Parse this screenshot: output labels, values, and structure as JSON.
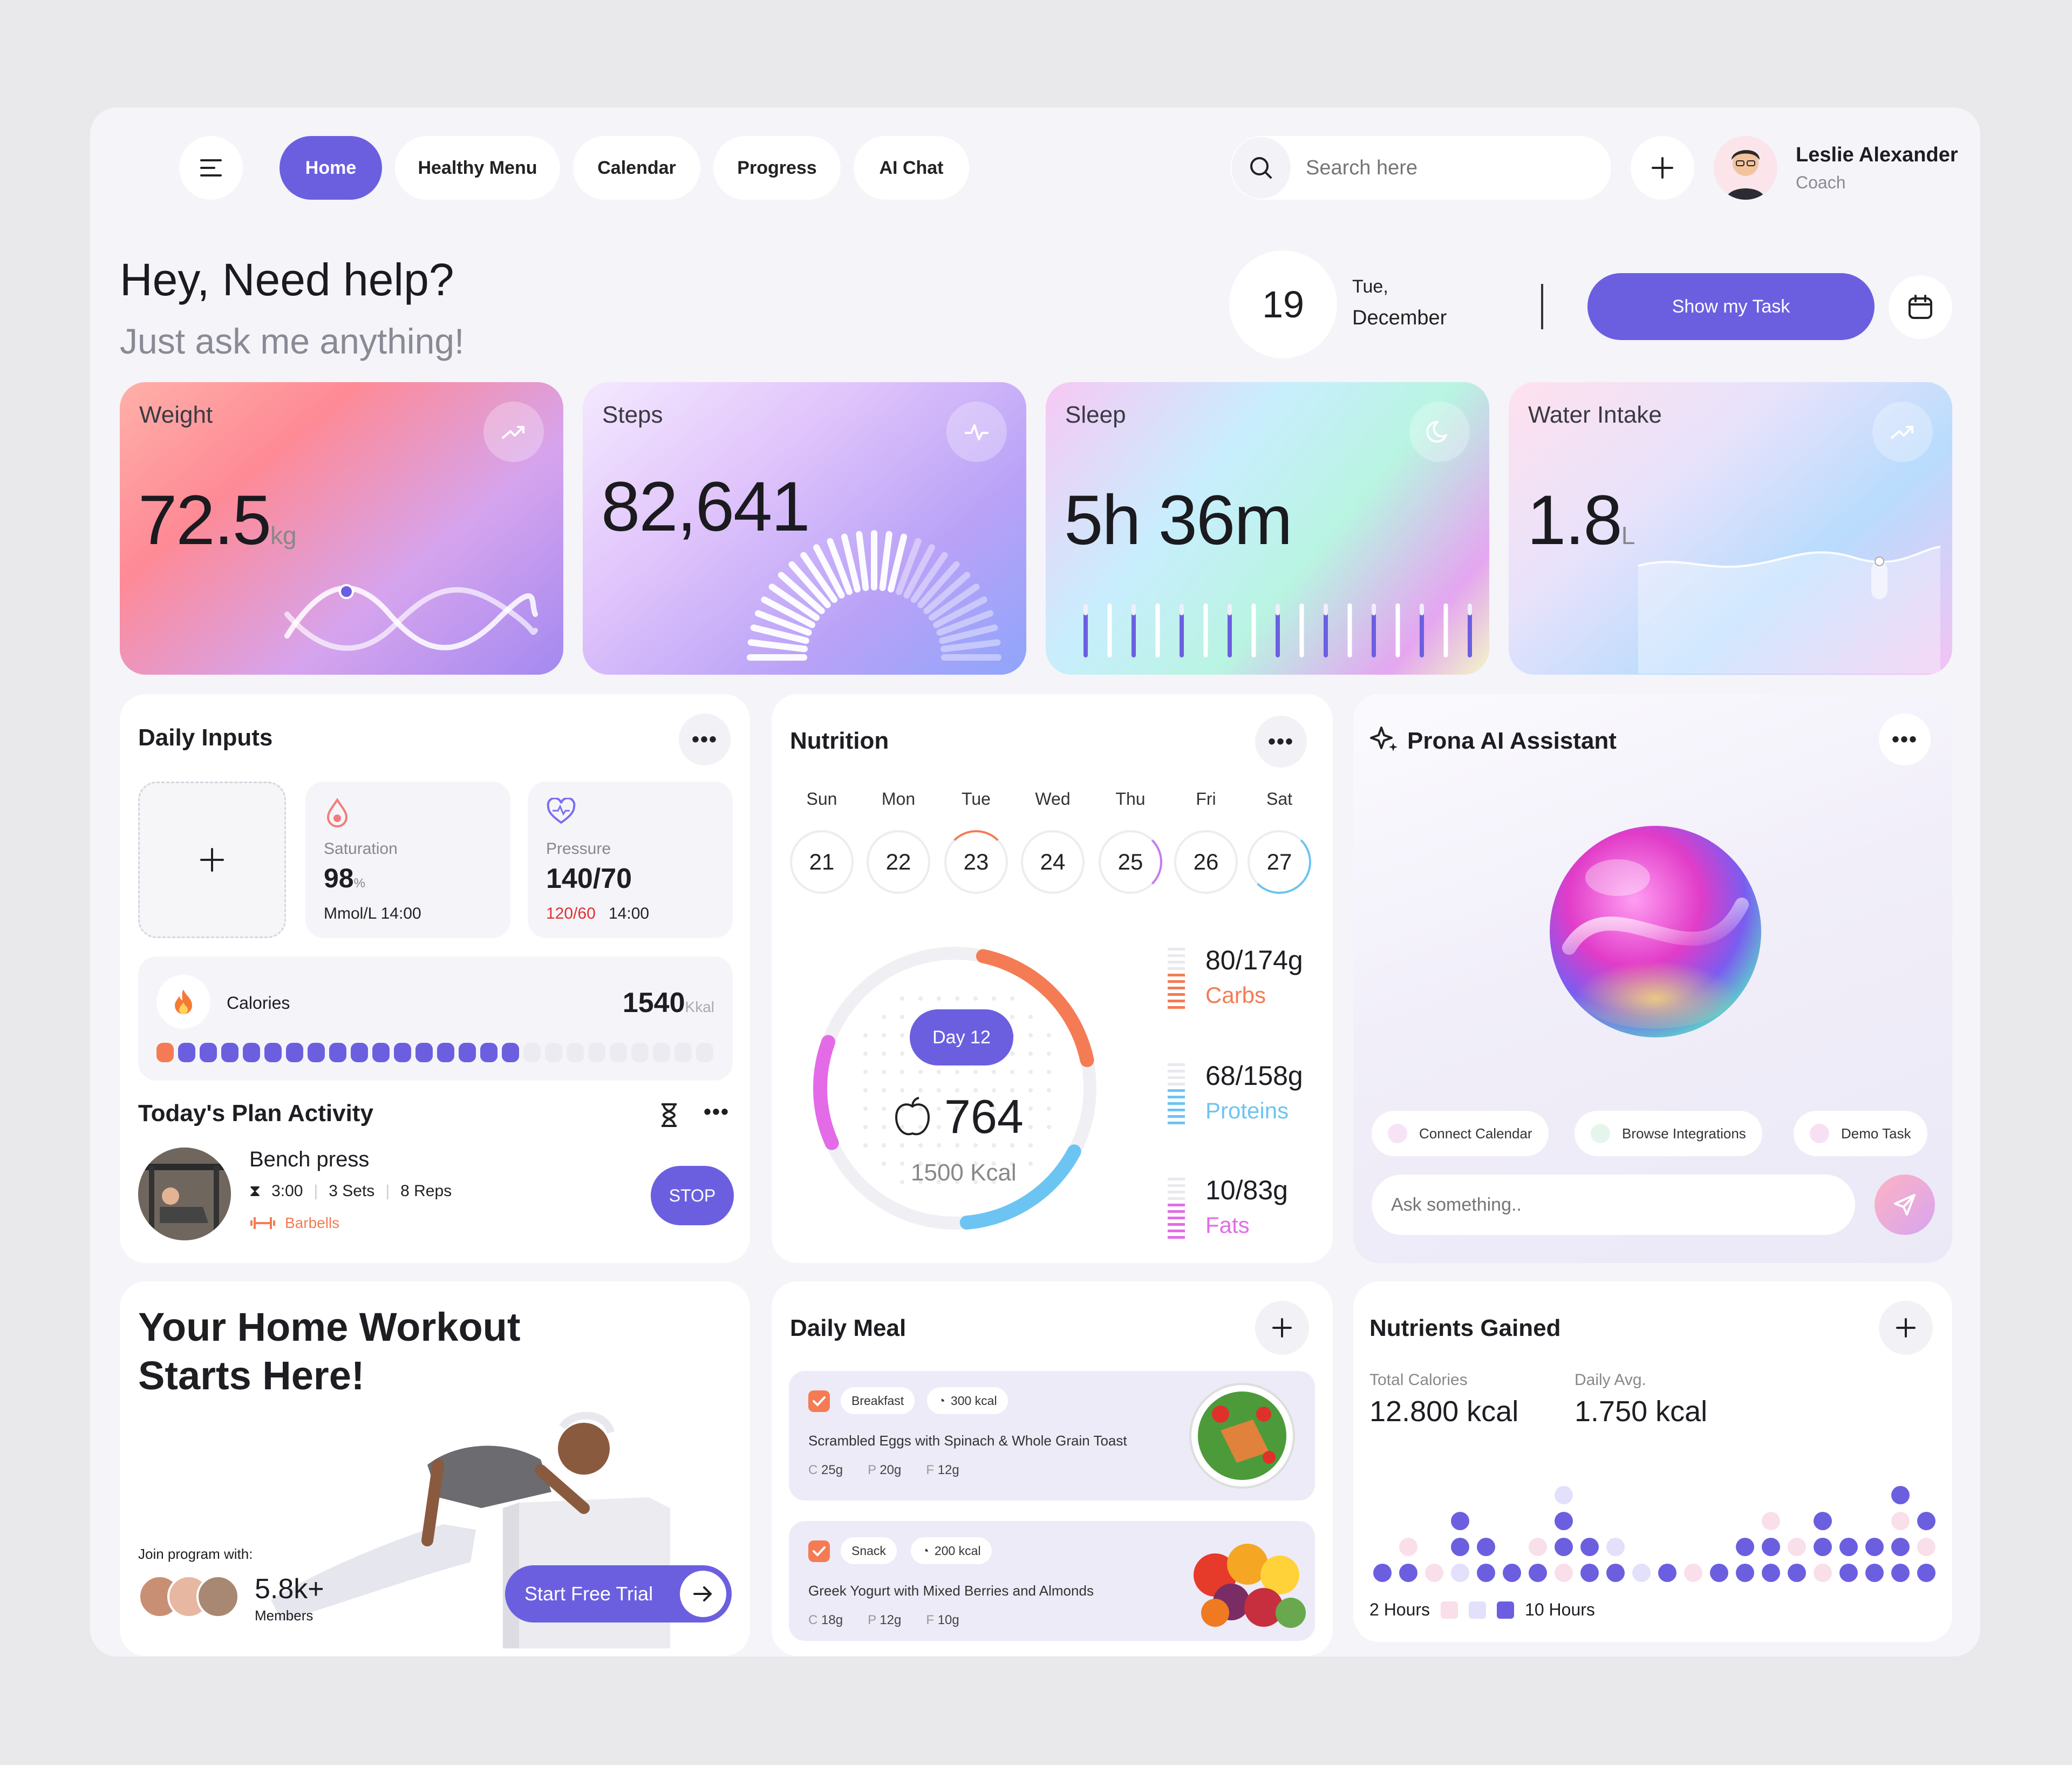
{
  "nav": {
    "items": [
      "Home",
      "Healthy Menu",
      "Calendar",
      "Progress",
      "AI Chat"
    ],
    "search_placeholder": "Search here"
  },
  "user": {
    "name": "Leslie Alexander",
    "role": "Coach"
  },
  "greeting": {
    "title": "Hey, Need help?",
    "subtitle": "Just ask me anything!"
  },
  "date": {
    "day": "19",
    "weekday": "Tue,",
    "month": "December",
    "task_button": "Show my Task"
  },
  "stats": {
    "weight": {
      "title": "Weight",
      "value": "72.5",
      "unit": "kg"
    },
    "steps": {
      "title": "Steps",
      "value": "82,641"
    },
    "sleep": {
      "title": "Sleep",
      "value": "5h 36m"
    },
    "water": {
      "title": "Water Intake",
      "value": "1.8",
      "unit": "L"
    }
  },
  "daily_inputs": {
    "title": "Daily Inputs",
    "saturation": {
      "label": "Saturation",
      "value": "98",
      "unit": "%",
      "detail": "Mmol/L 14:00"
    },
    "pressure": {
      "label": "Pressure",
      "value": "140/70",
      "low": "120/60",
      "time": "14:00"
    },
    "calories": {
      "label": "Calories",
      "value": "1540",
      "unit": "Kkal",
      "progress": 0.65
    }
  },
  "plan": {
    "title": "Today's Plan Activity",
    "exercise": "Bench press",
    "time": "3:00",
    "sets": "3 Sets",
    "reps": "8 Reps",
    "equipment": "Barbells",
    "stop": "STOP"
  },
  "nutrition": {
    "title": "Nutrition",
    "days": [
      {
        "name": "Sun",
        "num": "21"
      },
      {
        "name": "Mon",
        "num": "22"
      },
      {
        "name": "Tue",
        "num": "23"
      },
      {
        "name": "Wed",
        "num": "24"
      },
      {
        "name": "Thu",
        "num": "25"
      },
      {
        "name": "Fri",
        "num": "26"
      },
      {
        "name": "Sat",
        "num": "27"
      }
    ],
    "day_badge": "Day 12",
    "kcal": "764",
    "kcal_goal": "1500 Kcal",
    "carbs": {
      "value": "80/174g",
      "label": "Carbs"
    },
    "proteins": {
      "value": "68/158g",
      "label": "Proteins"
    },
    "fats": {
      "value": "10/83g",
      "label": "Fats"
    }
  },
  "ai": {
    "title": "Prona AI Assistant",
    "chips": [
      "Connect Calendar",
      "Browse Integrations",
      "Demo Task"
    ],
    "input_placeholder": "Ask something.."
  },
  "workout": {
    "title_1": "Your Home Workout",
    "title_2": "Starts Here!",
    "join": "Join program with:",
    "members_count": "5.8k+",
    "members_label": "Members",
    "cta": "Start Free Trial"
  },
  "meal": {
    "title": "Daily Meal",
    "items": [
      {
        "type": "Breakfast",
        "kcal": "300 kcal",
        "name": "Scrambled Eggs with Spinach & Whole Grain Toast",
        "c": "25g",
        "p": "20g",
        "f": "12g"
      },
      {
        "type": "Snack",
        "kcal": "200 kcal",
        "name": "Greek Yogurt with Mixed Berries and Almonds",
        "c": "18g",
        "p": "12g",
        "f": "10g"
      }
    ],
    "macro_c": "C",
    "macro_p": "P",
    "macro_f": "F"
  },
  "nutrients": {
    "title": "Nutrients Gained",
    "total_label": "Total Calories",
    "total": "12.800 kcal",
    "avg_label": "Daily Avg.",
    "avg": "1.750 kcal",
    "legend_min": "2 Hours",
    "legend_max": "10 Hours"
  },
  "colors": {
    "accent": "#6b5fe0",
    "orange": "#f47b54",
    "blue": "#6cc4f2",
    "pink": "#e46be8"
  }
}
